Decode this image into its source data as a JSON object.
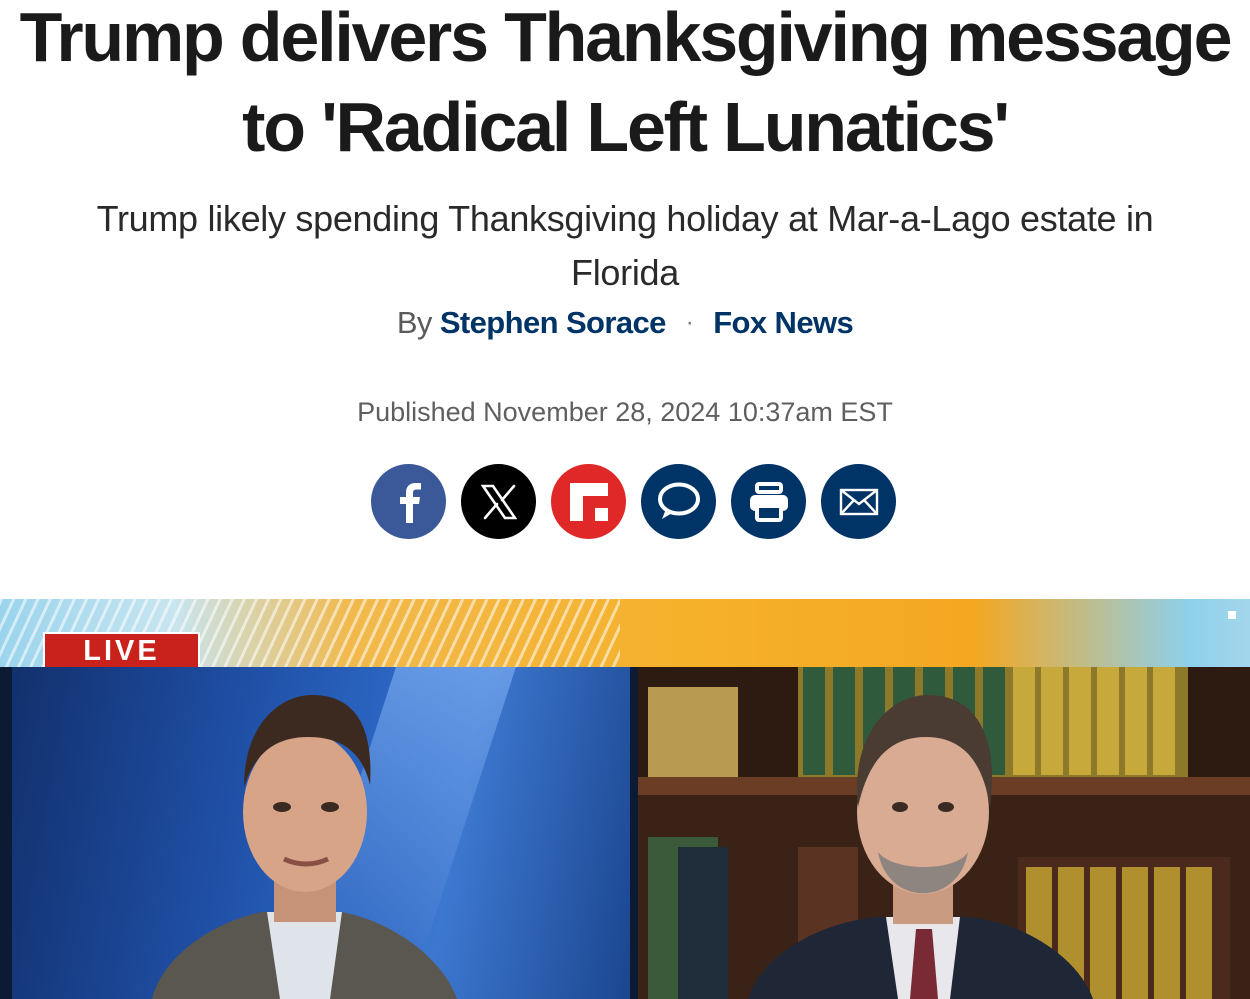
{
  "article": {
    "headline": "Trump delivers Thanksgiving message to 'Radical Left Lunatics'",
    "subheadline": "Trump likely spending Thanksgiving holiday at Mar-a-Lago estate in Florida",
    "byline": {
      "prefix": "By",
      "author": "Stephen Sorace",
      "separator": "·",
      "outlet": "Fox News"
    },
    "published": "Published November 28, 2024 10:37am EST"
  },
  "share": {
    "buttons": [
      {
        "name": "facebook",
        "icon": "facebook-icon",
        "color": "#3b5998"
      },
      {
        "name": "x",
        "icon": "x-icon",
        "color": "#000000"
      },
      {
        "name": "flipboard",
        "icon": "flipboard-icon",
        "color": "#e12828"
      },
      {
        "name": "comments",
        "icon": "comment-icon",
        "color": "#003366"
      },
      {
        "name": "print",
        "icon": "print-icon",
        "color": "#003366"
      },
      {
        "name": "email",
        "icon": "email-icon",
        "color": "#003366"
      }
    ]
  },
  "video": {
    "live_badge": "LIVE"
  },
  "colors": {
    "headline": "#1a1a1a",
    "link": "#003366",
    "live": "#c9211b"
  }
}
